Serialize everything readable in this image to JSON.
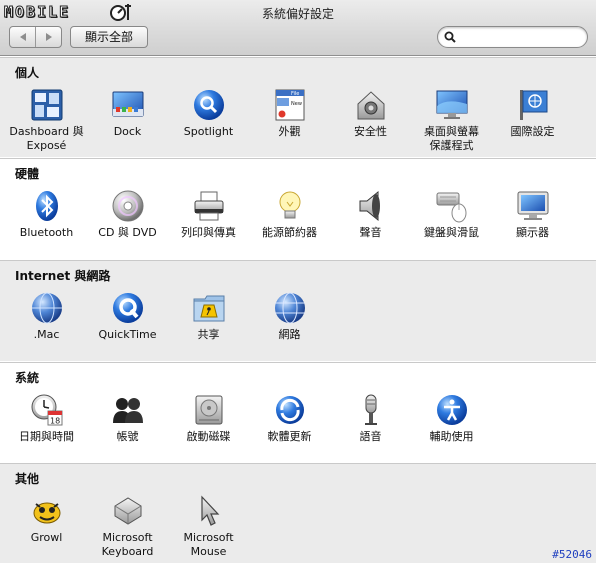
{
  "logo": {
    "text": "MOBILE"
  },
  "window": {
    "title": "系統偏好設定"
  },
  "toolbar": {
    "back_glyph": "◀",
    "forward_glyph": "▶",
    "show_all_label": "顯示全部"
  },
  "search": {
    "value": "",
    "placeholder": ""
  },
  "sections": [
    {
      "title": "個人",
      "items": [
        {
          "label": "Dashboard 與\nExposé",
          "icon": "dashboard-expose-icon"
        },
        {
          "label": "Dock",
          "icon": "dock-icon"
        },
        {
          "label": "Spotlight",
          "icon": "spotlight-icon"
        },
        {
          "label": "外觀",
          "icon": "appearance-icon"
        },
        {
          "label": "安全性",
          "icon": "security-icon"
        },
        {
          "label": "桌面與螢幕\n保護程式",
          "icon": "desktop-screensaver-icon"
        },
        {
          "label": "國際設定",
          "icon": "international-icon"
        }
      ]
    },
    {
      "title": "硬體",
      "items": [
        {
          "label": "Bluetooth",
          "icon": "bluetooth-icon"
        },
        {
          "label": "CD 與 DVD",
          "icon": "cd-dvd-icon"
        },
        {
          "label": "列印與傳真",
          "icon": "printer-icon"
        },
        {
          "label": "能源節約器",
          "icon": "energy-saver-icon"
        },
        {
          "label": "聲音",
          "icon": "sound-icon"
        },
        {
          "label": "鍵盤與滑鼠",
          "icon": "keyboard-mouse-icon"
        },
        {
          "label": "顯示器",
          "icon": "displays-icon"
        }
      ]
    },
    {
      "title": "Internet 與網路",
      "items": [
        {
          "label": ".Mac",
          "icon": "dotmac-icon"
        },
        {
          "label": "QuickTime",
          "icon": "quicktime-icon"
        },
        {
          "label": "共享",
          "icon": "sharing-icon"
        },
        {
          "label": "網路",
          "icon": "network-icon"
        }
      ]
    },
    {
      "title": "系統",
      "items": [
        {
          "label": "日期與時間",
          "icon": "date-time-icon",
          "badge": "18"
        },
        {
          "label": "帳號",
          "icon": "accounts-icon"
        },
        {
          "label": "啟動磁碟",
          "icon": "startup-disk-icon"
        },
        {
          "label": "軟體更新",
          "icon": "software-update-icon"
        },
        {
          "label": "語音",
          "icon": "speech-icon"
        },
        {
          "label": "輔助使用",
          "icon": "universal-access-icon"
        }
      ]
    },
    {
      "title": "其他",
      "items": [
        {
          "label": "Growl",
          "icon": "growl-icon"
        },
        {
          "label": "Microsoft\nKeyboard",
          "icon": "ms-keyboard-icon"
        },
        {
          "label": "Microsoft\nMouse",
          "icon": "ms-mouse-icon"
        }
      ]
    }
  ],
  "watermark": "#52046",
  "colors": {
    "section_gray": "#ebebeb",
    "link_blue": "#1f3fbf"
  }
}
